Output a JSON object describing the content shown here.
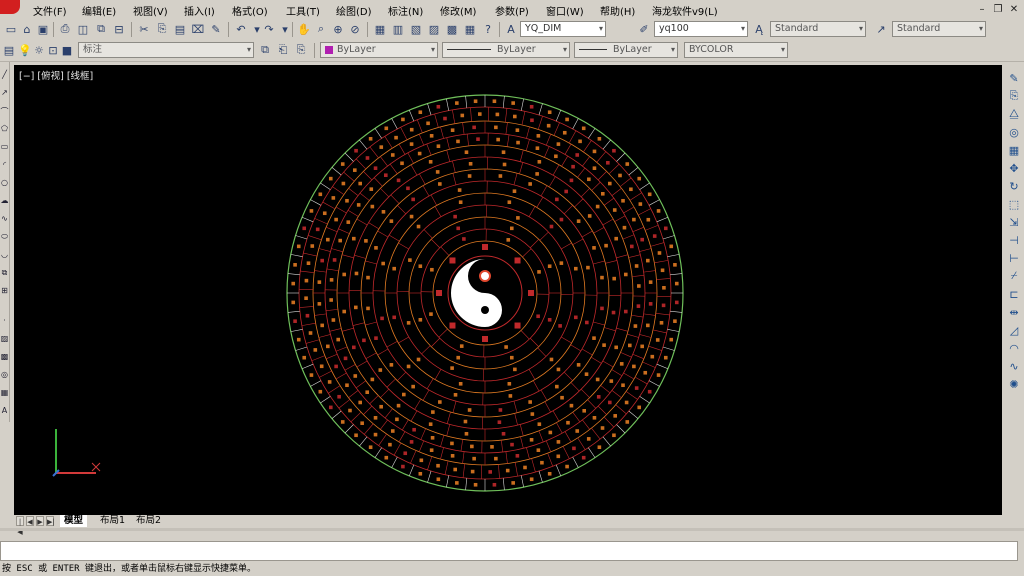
{
  "menu": {
    "items": [
      "文件(F)",
      "编辑(E)",
      "视图(V)",
      "插入(I)",
      "格式(O)",
      "工具(T)",
      "绘图(D)",
      "标注(N)",
      "修改(M)",
      "参数(P)",
      "窗口(W)",
      "帮助(H)",
      "海龙软件v9(L)"
    ]
  },
  "toolbar1": {
    "dimstyle": "YQ_DIM",
    "scale": "yq100",
    "textstyle": "Standard",
    "tablestyle": "Standard"
  },
  "toolbar2": {
    "layer": "标注",
    "color": "ByLayer",
    "linetype": "ByLayer",
    "lineweight": "ByLayer",
    "plotstyle": "BYCOLOR"
  },
  "viewport": {
    "label": "[−] [俯视] [线框]"
  },
  "tabs": [
    "模型",
    "布局1",
    "布局2"
  ],
  "command": {
    "status": "按 ESC 或 ENTER 键退出，或者单击鼠标右键显示快捷菜单。"
  },
  "colors": {
    "canvas_bg": "#000000",
    "ring_red": "#c0292b",
    "ring_orange": "#e07a22",
    "outer_green": "#6fbf5a",
    "taiji_white": "#ffffff"
  }
}
